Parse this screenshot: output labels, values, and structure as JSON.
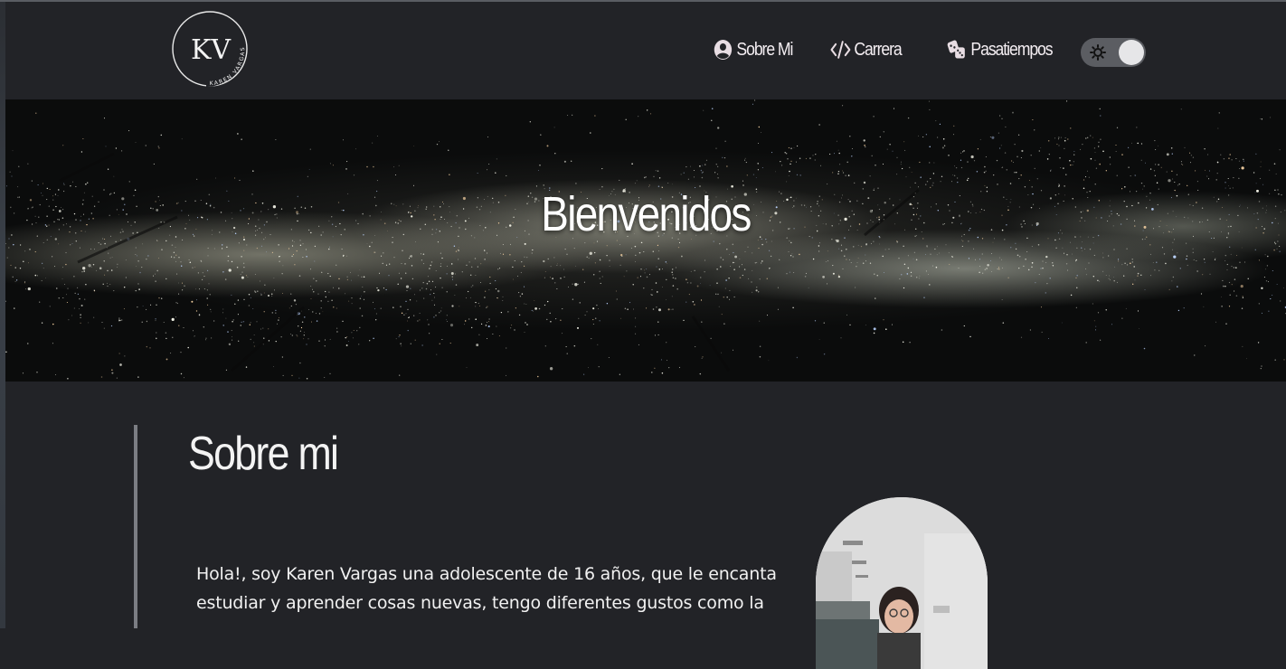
{
  "header": {
    "logo": {
      "text": "KV",
      "subtext": "KAREN VARGAS"
    },
    "nav": [
      {
        "label": "Sobre Mi",
        "icon": "user-circle-icon"
      },
      {
        "label": "Carrera",
        "icon": "code-icon"
      },
      {
        "label": "Pasatiempos",
        "icon": "dice-icon"
      }
    ],
    "theme_toggle": {
      "icon": "sun-icon",
      "state": "off"
    }
  },
  "hero": {
    "title": "Bienvenidos"
  },
  "about": {
    "title": "Sobre mi",
    "text": "Hola!, soy Karen Vargas una adolescente de 16 años, que le encanta estudiar y aprender cosas nuevas, tengo diferentes gustos como la"
  },
  "colors": {
    "background": "#222327",
    "text": "#f3f3f3",
    "accent_line": "#7b7d83",
    "toggle_track": "#5b5d62"
  }
}
